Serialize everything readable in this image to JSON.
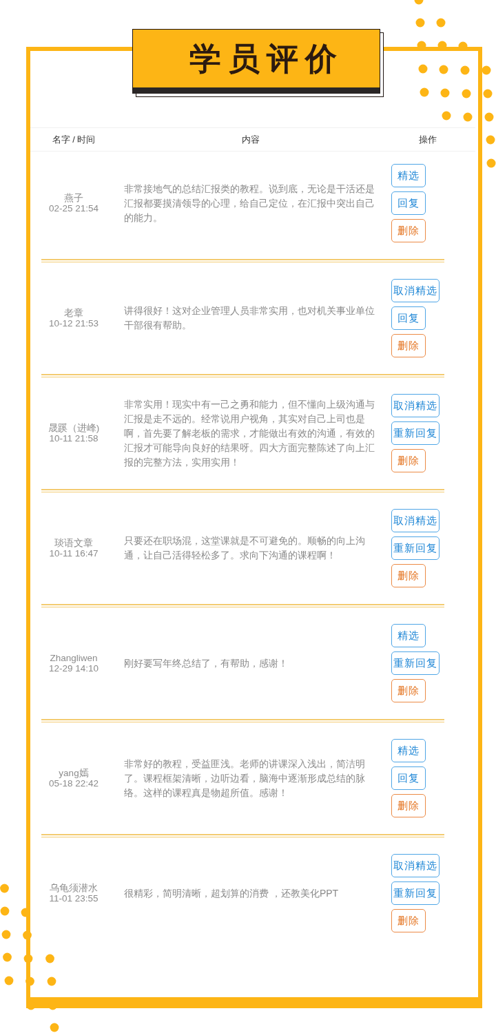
{
  "title": "学员评价",
  "table": {
    "columns": [
      "名字 / 时间",
      "内容",
      "操作"
    ],
    "rows": [
      {
        "name": "燕子",
        "time": "02-25 21:54",
        "content": "非常接地气的总结汇报类的教程。说到底，无论是干活还是汇报都要摸清领导的心理，给自己定位，在汇报中突出自己的能力。",
        "actions": [
          {
            "label": "精选",
            "kind": "feature"
          },
          {
            "label": "回复",
            "kind": "reply"
          },
          {
            "label": "删除",
            "kind": "delete"
          }
        ]
      },
      {
        "name": "老章",
        "time": "10-12 21:53",
        "content": "讲得很好！这对企业管理人员非常实用，也对机关事业单位干部很有帮助。",
        "actions": [
          {
            "label": "取消精选",
            "kind": "feature"
          },
          {
            "label": "回复",
            "kind": "reply"
          },
          {
            "label": "删除",
            "kind": "delete"
          }
        ]
      },
      {
        "name": "晟蹊（进峰)",
        "time": "10-11 21:58",
        "content": "非常实用！现实中有一己之勇和能力，但不懂向上级沟通与汇报是走不远的。经常说用户视角，其实对自己上司也是啊，首先要了解老板的需求，才能做出有效的沟通，有效的汇报才可能导向良好的结果呀。四大方面完整陈述了向上汇报的完整方法，实用实用！",
        "actions": [
          {
            "label": "取消精选",
            "kind": "feature"
          },
          {
            "label": "重新回复",
            "kind": "reply"
          },
          {
            "label": "删除",
            "kind": "delete"
          }
        ]
      },
      {
        "name": "琰语文章",
        "time": "10-11 16:47",
        "content": "只要还在职场混，这堂课就是不可避免的。顺畅的向上沟通，让自己活得轻松多了。求向下沟通的课程啊！",
        "actions": [
          {
            "label": "取消精选",
            "kind": "feature"
          },
          {
            "label": "重新回复",
            "kind": "reply"
          },
          {
            "label": "删除",
            "kind": "delete"
          }
        ]
      },
      {
        "name": "Zhangliwen",
        "time": "12-29 14:10",
        "content": "刚好要写年终总结了，有帮助，感谢！",
        "actions": [
          {
            "label": "精选",
            "kind": "feature"
          },
          {
            "label": "重新回复",
            "kind": "reply"
          },
          {
            "label": "删除",
            "kind": "delete"
          }
        ]
      },
      {
        "name": "yang嫣",
        "time": "05-18 22:42",
        "content": "非常好的教程，受益匪浅。老师的讲课深入浅出，简洁明了。课程框架清晰，边听边看，脑海中逐渐形成总结的脉络。这样的课程真是物超所值。感谢！",
        "actions": [
          {
            "label": "精选",
            "kind": "feature"
          },
          {
            "label": "回复",
            "kind": "reply"
          },
          {
            "label": "删除",
            "kind": "delete"
          }
        ]
      },
      {
        "name": "乌龟须潜水",
        "time": "11-01 23:55",
        "content": "很精彩，简明清晰，超划算的消费 ，还教美化PPT",
        "actions": [
          {
            "label": "取消精选",
            "kind": "feature"
          },
          {
            "label": "重新回复",
            "kind": "reply"
          },
          {
            "label": "删除",
            "kind": "delete"
          }
        ]
      }
    ]
  }
}
